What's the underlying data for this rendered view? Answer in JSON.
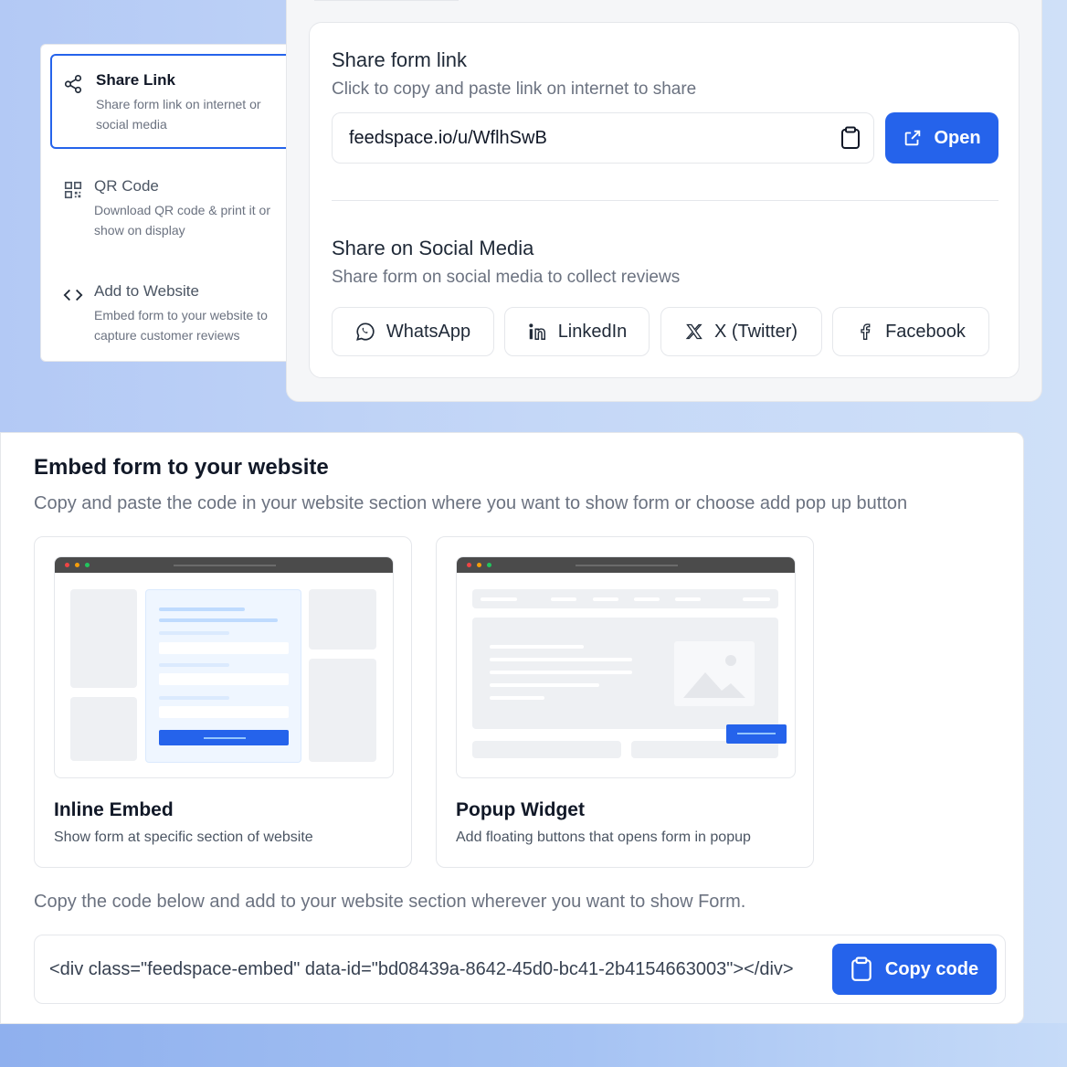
{
  "menu": {
    "items": [
      {
        "icon": "share-icon",
        "title": "Share Link",
        "desc_line1": "Share form link on internet or",
        "desc_line2": "social media"
      },
      {
        "icon": "qr-code-icon",
        "title": "QR Code",
        "desc_line1": "Download QR code & print it or",
        "desc_line2": "show on display"
      },
      {
        "icon": "code-icon",
        "title": "Add to Website",
        "desc_line1": "Embed form to your website to",
        "desc_line2": "capture customer reviews"
      }
    ]
  },
  "share": {
    "title": "Share form link",
    "subtitle": "Click to copy and paste link on internet to share",
    "link_value": "feedspace.io/u/WflhSwB",
    "open_label": "Open",
    "social_title": "Share on Social Media",
    "social_subtitle": "Share form on social media to collect reviews",
    "social_buttons": [
      {
        "icon": "whatsapp-icon",
        "label": "WhatsApp"
      },
      {
        "icon": "linkedin-icon",
        "label": "LinkedIn"
      },
      {
        "icon": "x-twitter-icon",
        "label": "X (Twitter)"
      },
      {
        "icon": "facebook-icon",
        "label": "Facebook"
      }
    ]
  },
  "embed": {
    "title": "Embed form to your website",
    "subtitle": "Copy and paste the code in your website section where you want to show form or choose add pop up button",
    "options": [
      {
        "title": "Inline Embed",
        "desc": "Show form at specific section of website"
      },
      {
        "title": "Popup Widget",
        "desc": "Add floating buttons that opens form in popup"
      }
    ],
    "code_label": "Copy the code below and add to your website section wherever you want to show Form.",
    "code_value": "<div class=\"feedspace-embed\" data-id=\"bd08439a-8642-45d0-bc41-2b4154663003\"></div>",
    "copy_label": "Copy code"
  },
  "colors": {
    "accent": "#2563eb",
    "border": "#e5e7eb",
    "muted_text": "#6b7280"
  }
}
